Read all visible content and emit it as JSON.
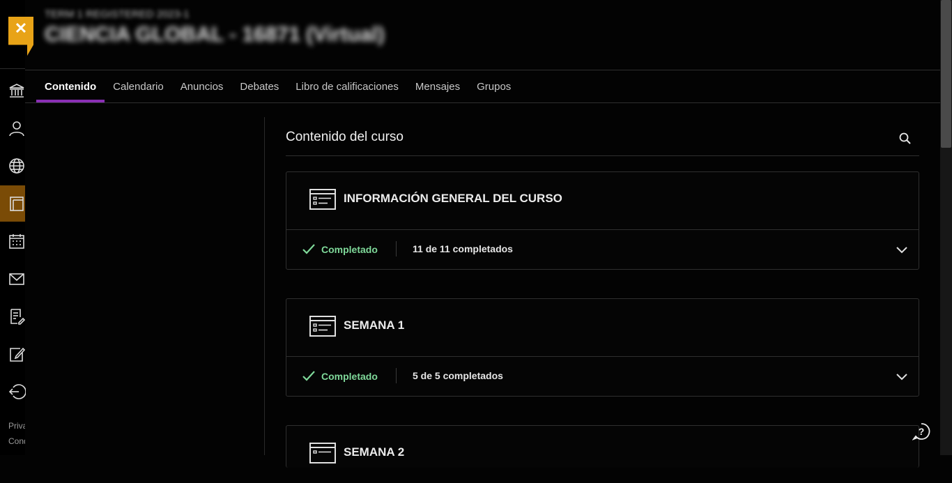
{
  "header": {
    "close_symbol": "✕",
    "course_subtitle": "TERM 1 REGISTERED 2023-1",
    "course_title": "CIENCIA GLOBAL - 16871 (Virtual)"
  },
  "tabs": [
    {
      "label": "Contenido",
      "active": true
    },
    {
      "label": "Calendario"
    },
    {
      "label": "Anuncios"
    },
    {
      "label": "Debates"
    },
    {
      "label": "Libro de calificaciones"
    },
    {
      "label": "Mensajes"
    },
    {
      "label": "Grupos"
    }
  ],
  "sidebar": {
    "icons": [
      "institution-icon",
      "person-icon",
      "globe-icon",
      "course-icon",
      "calendar-icon",
      "mail-icon",
      "grades-icon",
      "edit-icon",
      "signout-icon"
    ],
    "footer_privacy": "Priva",
    "footer_conditions": "Cond"
  },
  "content": {
    "title": "Contenido del curso",
    "modules": [
      {
        "title": "INFORMACIÓN GENERAL DEL CURSO",
        "status": "Completado",
        "progress": "11 de 11 completados"
      },
      {
        "title": "SEMANA 1",
        "status": "Completado",
        "progress": "5 de 5 completados"
      },
      {
        "title": "SEMANA 2"
      }
    ]
  },
  "colors": {
    "accent": "#e8a317",
    "tab_underline": "#8a2fb5",
    "completed": "#7fd99a",
    "background": "#030303"
  }
}
